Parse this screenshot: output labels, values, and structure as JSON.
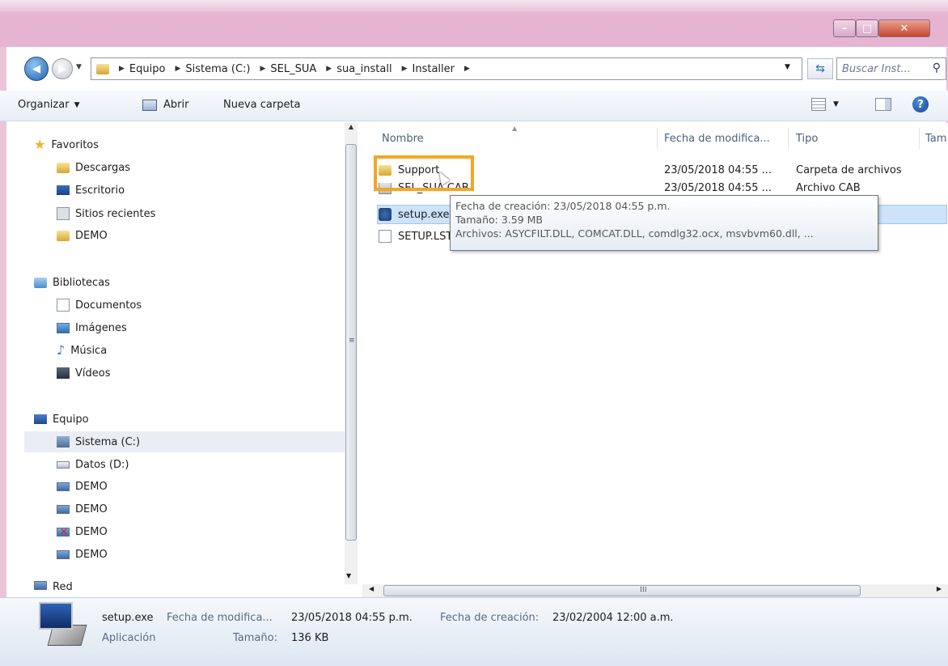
{
  "window": {
    "controls": {
      "minimize": "–",
      "maximize": "□",
      "close": "✕"
    }
  },
  "address": {
    "breadcrumbs": [
      "Equipo",
      "Sistema (C:)",
      "SEL_SUA",
      "sua_install",
      "Installer"
    ],
    "search_placeholder": "Buscar Inst...",
    "refresh_icon": "refresh-icon"
  },
  "toolbar": {
    "organize": "Organizar",
    "open": "Abrir",
    "new_folder": "Nueva carpeta",
    "help": "?"
  },
  "nav": {
    "favorites": {
      "label": "Favoritos",
      "items": [
        "Descargas",
        "Escritorio",
        "Sitios recientes",
        "DEMO"
      ]
    },
    "libraries": {
      "label": "Bibliotecas",
      "items": [
        "Documentos",
        "Imágenes",
        "Música",
        "Vídeos"
      ]
    },
    "computer": {
      "label": "Equipo",
      "items": [
        "Sistema (C:)",
        "Datos (D:)",
        "DEMO",
        "DEMO",
        "DEMO",
        "DEMO"
      ]
    },
    "network": {
      "label": "Red"
    },
    "selected": "Sistema (C:)"
  },
  "list": {
    "columns": [
      "Nombre",
      "Fecha de modifica...",
      "Tipo",
      "Tam"
    ],
    "rows": [
      {
        "name": "Support",
        "date": "23/05/2018 04:55 ...",
        "type": "Carpeta de archivos",
        "icon": "folder-icon"
      },
      {
        "name": "SEL_SUA.CAB",
        "date": "23/05/2018 04:55 ...",
        "type": "Archivo CAB",
        "icon": "cab-icon"
      },
      {
        "name": "setup.exe",
        "date": "",
        "type": "",
        "icon": "exe-icon"
      },
      {
        "name": "SETUP.LST",
        "date": "",
        "type": "",
        "icon": "file-icon"
      }
    ],
    "selected_row": "setup.exe",
    "highlighted_item": "Support"
  },
  "tooltip": {
    "line1": "Fecha de creación: 23/05/2018 04:55 p.m.",
    "line2": "Tamaño: 3.59 MB",
    "line3": "Archivos: ASYCFILT.DLL, COMCAT.DLL, comdlg32.ocx, msvbvm60.dll, ..."
  },
  "details": {
    "filename": "setup.exe",
    "modified_label": "Fecha de modifica...",
    "modified_value": "23/05/2018 04:55 p.m.",
    "created_label": "Fecha de creación:",
    "created_value": "23/02/2004 12:00 a.m.",
    "type_label": "Aplicación",
    "size_label": "Tamaño:",
    "size_value": "136 KB"
  },
  "colors": {
    "title_bar": "#e6b3d0",
    "selection": "#cce3f9",
    "highlight_box": "#f5a623",
    "close_button": "#c7462f"
  }
}
